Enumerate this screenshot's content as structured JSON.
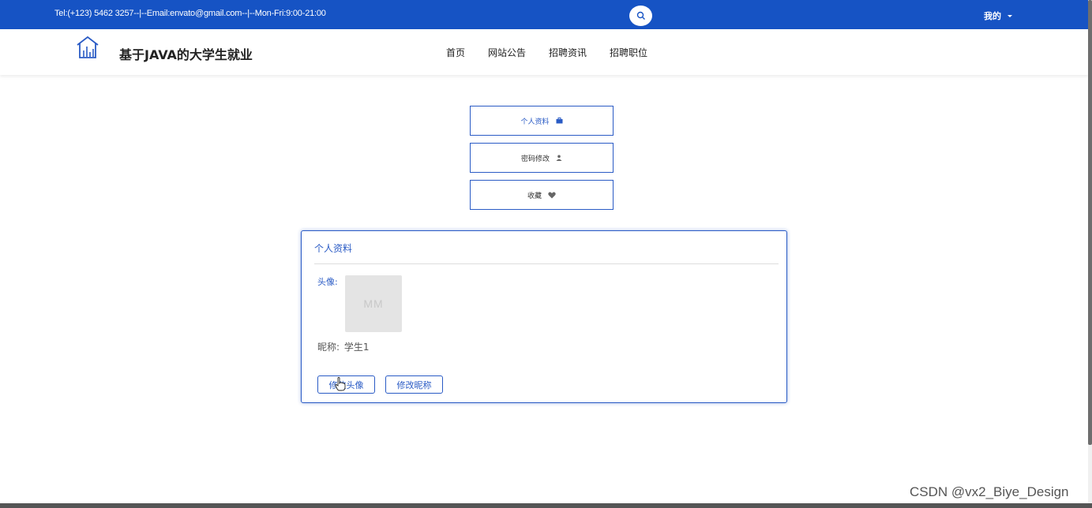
{
  "topbar": {
    "contact": "Tel:(+123) 5462 3257--|--Email:envato@gmail.com--|--Mon-Fri:9:00-21:00",
    "search_icon": "search-icon",
    "mine_label": "我的"
  },
  "navbar": {
    "logo_icon": "house-chart-icon",
    "site_title": "基于JAVA的大学生就业",
    "links": [
      "首页",
      "网站公告",
      "招聘资讯",
      "招聘职位"
    ]
  },
  "side_menu": [
    {
      "label": "个人资料",
      "icon": "briefcase-icon",
      "active": true
    },
    {
      "label": "密码修改",
      "icon": "user-icon",
      "active": false
    },
    {
      "label": "收藏",
      "icon": "heart-icon",
      "active": false
    }
  ],
  "profile": {
    "title": "个人资料",
    "avatar_label": "头像:",
    "avatar_placeholder": "MM",
    "nickname_label": "昵称:",
    "nickname_value": "学生1",
    "change_avatar_btn": "修改头像",
    "change_nickname_btn": "修改昵称"
  },
  "watermark": "CSDN @vx2_Biye_Design",
  "colors": {
    "primary": "#1653c4",
    "accent": "#2a5bc5"
  }
}
